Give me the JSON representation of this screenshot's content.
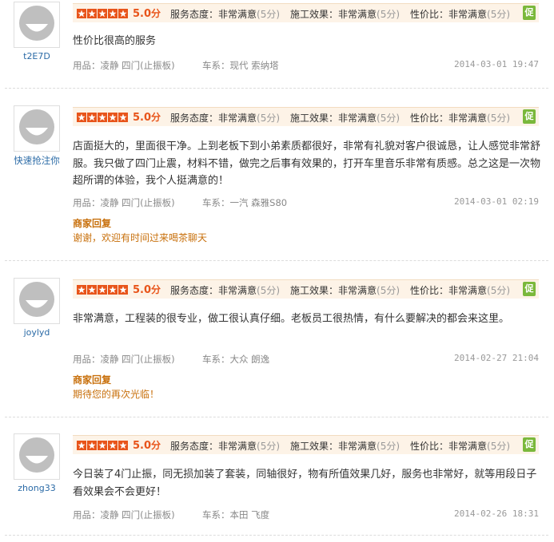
{
  "labels": {
    "rating_unit": "分",
    "service_label": "服务态度：非常满意",
    "work_label": "施工效果：非常满意",
    "value_label": "性价比：非常满意",
    "points": "(5分)",
    "product_prefix": "用品：",
    "car_prefix": "车系：",
    "reply_title": "商家回复",
    "shield_glyph": "促"
  },
  "colors": {
    "accent": "#e8541a",
    "link": "#2a6aa6",
    "reply": "#c8700c",
    "badge": "#7ab83b"
  },
  "reviews": [
    {
      "user": "t2E7D",
      "score": "5.0",
      "content": "性价比很高的服务",
      "product": "凌静 四门(止振板)",
      "car": "现代 索纳塔",
      "date": "2014-03-01 19:47"
    },
    {
      "user": "快速抢注你",
      "score": "5.0",
      "content": "店面挺大的，里面很干净。上到老板下到小弟素质都很好，非常有礼貌对客户很诚恳，让人感觉非常舒服。我只做了四门止震，材料不错，做完之后事有效果的，打开车里音乐非常有质感。总之这是一次物超所谓的体验，我个人挺满意的！",
      "product": "凌静 四门(止振板)",
      "car": "一汽 森雅S80",
      "date": "2014-03-01 02:19",
      "reply": "谢谢，欢迎有时间过来喝茶聊天"
    },
    {
      "user": "joylyd",
      "score": "5.0",
      "content": "非常满意，工程装的很专业，做工很认真仔细。老板员工很热情，有什么要解决的都会来这里。",
      "product": "凌静 四门(止振板)",
      "car": "大众 朗逸",
      "date": "2014-02-27 21:04",
      "reply": "期待您的再次光临！"
    },
    {
      "user": "zhong33",
      "score": "5.0",
      "content": "今日装了4门止振，同无损加装了套装，同轴很好，物有所值效果几好，服务也非常好，就等用段日子看效果会不会更好！",
      "product": "凌静 四门(止振板)",
      "car": "本田 飞度",
      "date": "2014-02-26 18:31"
    }
  ]
}
